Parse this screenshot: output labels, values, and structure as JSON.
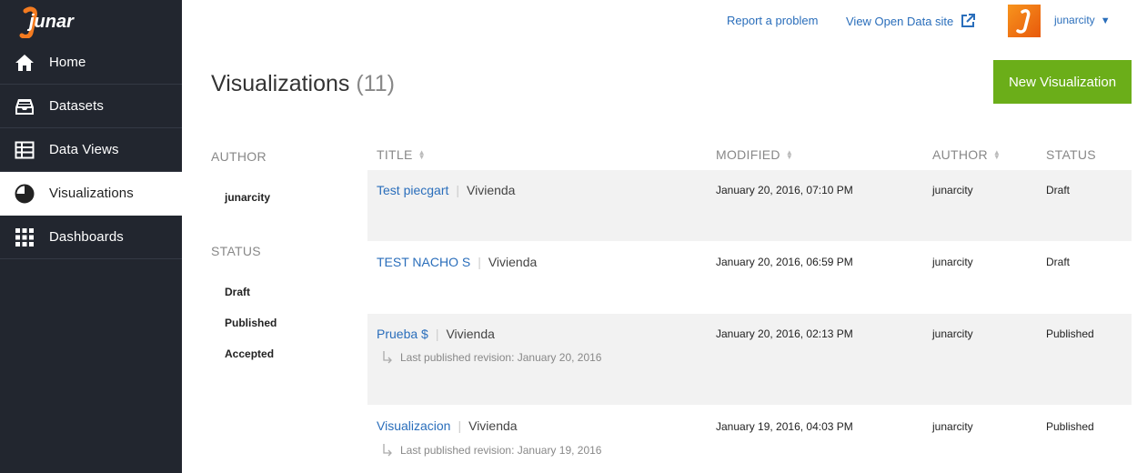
{
  "brand": {
    "logo_text": "junar"
  },
  "sidebar": {
    "items": [
      {
        "label": "Home",
        "icon": "home-icon"
      },
      {
        "label": "Datasets",
        "icon": "inbox-icon"
      },
      {
        "label": "Data Views",
        "icon": "table-icon"
      },
      {
        "label": "Visualizations",
        "icon": "pie-chart-icon",
        "active": true
      },
      {
        "label": "Dashboards",
        "icon": "grid-icon"
      }
    ]
  },
  "topbar": {
    "report_label": "Report a problem",
    "open_data_label": "View Open Data site",
    "username": "junarcity",
    "caret": "▼"
  },
  "header": {
    "title": "Visualizations",
    "count": "(11)",
    "new_button": "New Visualization"
  },
  "filters": {
    "author_heading": "AUTHOR",
    "authors": [
      "junarcity"
    ],
    "status_heading": "STATUS",
    "statuses": [
      "Draft",
      "Published",
      "Accepted"
    ]
  },
  "table": {
    "columns": [
      "TITLE",
      "MODIFIED",
      "AUTHOR",
      "STATUS"
    ],
    "rows": [
      {
        "title": "Test piecgart",
        "category": "Vivienda",
        "modified": "January 20, 2016, 07:10 PM",
        "author": "junarcity",
        "status": "Draft",
        "revision": ""
      },
      {
        "title": "TEST NACHO S",
        "category": "Vivienda",
        "modified": "January 20, 2016, 06:59 PM",
        "author": "junarcity",
        "status": "Draft",
        "revision": ""
      },
      {
        "title": "Prueba $",
        "category": "Vivienda",
        "modified": "January 20, 2016, 02:13 PM",
        "author": "junarcity",
        "status": "Published",
        "revision": "Last published revision: January 20, 2016"
      },
      {
        "title": "Visualizacion",
        "category": "Vivienda",
        "modified": "January 19, 2016, 04:03 PM",
        "author": "junarcity",
        "status": "Published",
        "revision": "Last published revision: January 19, 2016"
      }
    ]
  },
  "colors": {
    "sidebar_bg": "#22262f",
    "accent_green": "#6bae19",
    "link_blue": "#2a6ebb",
    "row_shade": "#f2f2f2"
  }
}
